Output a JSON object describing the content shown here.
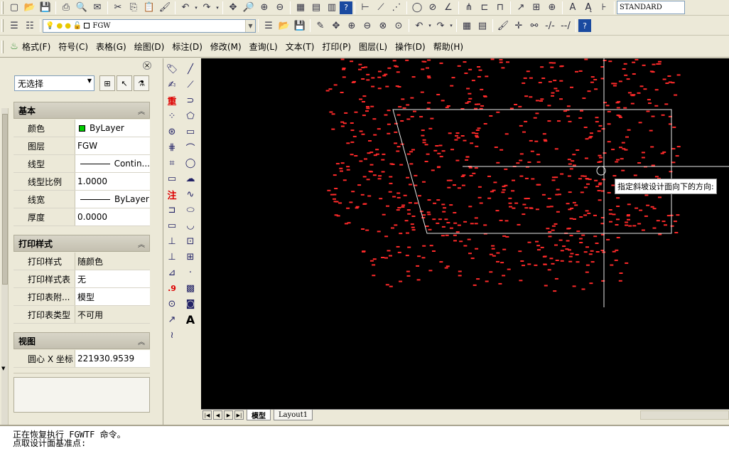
{
  "toolbar": {
    "text_style": "STANDARD",
    "layer_name": "FGW"
  },
  "menu": {
    "items": [
      "格式(F)",
      "符号(C)",
      "表格(G)",
      "绘图(D)",
      "标注(D)",
      "修改(M)",
      "查询(L)",
      "文本(T)",
      "打印(P)",
      "图层(L)",
      "操作(D)",
      "帮助(H)"
    ]
  },
  "properties": {
    "selection": "无选择",
    "sections": {
      "basic": "基本",
      "plot_style": "打印样式",
      "view": "视图"
    },
    "basic_rows": [
      {
        "key": "颜色",
        "value": "ByLayer",
        "swatch": "#00cc00"
      },
      {
        "key": "图层",
        "value": "FGW"
      },
      {
        "key": "线型",
        "value": "Contin..."
      },
      {
        "key": "线型比例",
        "value": "1.0000"
      },
      {
        "key": "线宽",
        "value": "ByLayer"
      },
      {
        "key": "厚度",
        "value": "0.0000"
      }
    ],
    "plot_rows": [
      {
        "key": "打印样式",
        "value": "随颜色"
      },
      {
        "key": "打印样式表",
        "value": "无"
      },
      {
        "key": "打印表附...",
        "value": "模型"
      },
      {
        "key": "打印表类型",
        "value": "不可用"
      }
    ],
    "view_rows": [
      {
        "key": "圆心 X 坐标",
        "value": "221930.9539"
      }
    ]
  },
  "draw_tools": {
    "text_icons": [
      "重",
      "注",
      ".9",
      "A"
    ]
  },
  "canvas": {
    "tooltip": "指定斜坡设计面向下的方向:",
    "background": "#000000",
    "point_color": "#ff2a2a"
  },
  "tabs": {
    "model": "模型",
    "layout1": "Layout1"
  },
  "command": {
    "line1": "正在恢复执行 FGWTF 命令。",
    "line2": "点取设计面基准点:"
  }
}
